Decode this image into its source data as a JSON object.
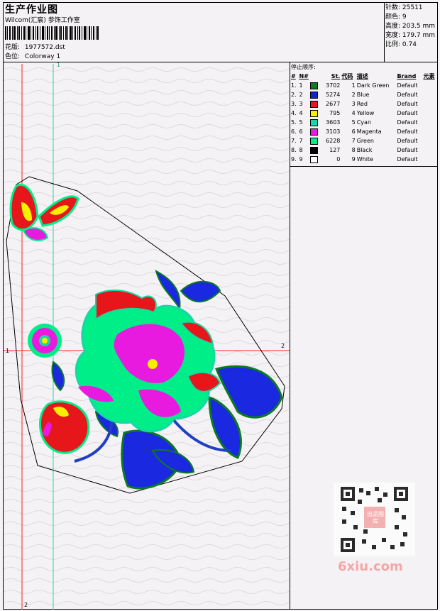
{
  "header": {
    "title": "生产作业图",
    "company": "Wilcom(汇宸) 参饰工作室",
    "design_label": "花版:",
    "design_value": "1977572.dst",
    "colorway_label": "色位:",
    "colorway_value": "Colorway 1"
  },
  "stats": {
    "stitches": "针数: 25511",
    "colors": "颜色: 9",
    "height": "高度: 203.5 mm",
    "width": "宽度: 179.7 mm",
    "scale": "比例: 0.74"
  },
  "color_table": {
    "caption": "停止顺序:",
    "headers": [
      "#",
      "N#",
      "St.",
      "代码",
      "描述",
      "Brand",
      "元素"
    ],
    "rows": [
      {
        "idx": "1.",
        "n": "1",
        "st": "3702",
        "code": "1",
        "desc": "Dark Green",
        "brand": "Default",
        "color": "#0b7a21"
      },
      {
        "idx": "2.",
        "n": "2",
        "st": "5274",
        "code": "2",
        "desc": "Blue",
        "brand": "Default",
        "color": "#1020e0"
      },
      {
        "idx": "3.",
        "n": "3",
        "st": "2677",
        "code": "3",
        "desc": "Red",
        "brand": "Default",
        "color": "#e6161a"
      },
      {
        "idx": "4.",
        "n": "4",
        "st": "795",
        "code": "4",
        "desc": "Yellow",
        "brand": "Default",
        "color": "#f5f000"
      },
      {
        "idx": "5.",
        "n": "5",
        "st": "3603",
        "code": "5",
        "desc": "Cyan",
        "brand": "Default",
        "color": "#18d6a6"
      },
      {
        "idx": "6.",
        "n": "6",
        "st": "3103",
        "code": "6",
        "desc": "Magenta",
        "brand": "Default",
        "color": "#e81ae0"
      },
      {
        "idx": "7.",
        "n": "7",
        "st": "6228",
        "code": "7",
        "desc": "Green",
        "brand": "Default",
        "color": "#00ee88"
      },
      {
        "idx": "8.",
        "n": "8",
        "st": "127",
        "code": "8",
        "desc": "Black",
        "brand": "Default",
        "color": "#000000"
      },
      {
        "idx": "9.",
        "n": "9",
        "st": "0",
        "code": "9",
        "desc": "White",
        "brand": "Default",
        "color": "#ffffff"
      }
    ]
  },
  "guides": {
    "top_green": "1",
    "left_red": "1",
    "right_red": "2",
    "bottom_red": "2"
  },
  "watermark": {
    "text": "6xiu.com",
    "stamp": "出品图库"
  }
}
